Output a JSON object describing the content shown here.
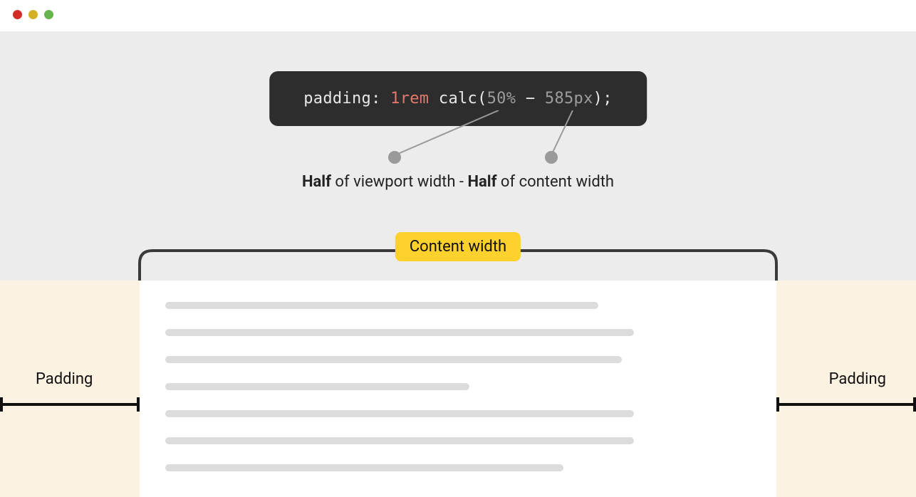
{
  "window": {
    "traffic_light_colors": [
      "#d42d27",
      "#d4b124",
      "#67b34c"
    ]
  },
  "code": {
    "property": "padding",
    "colon": ":",
    "value1": "1rem",
    "func": "calc",
    "lparen": "(",
    "arg1": "50%",
    "operator": "−",
    "arg2": "585px",
    "rparen": ")",
    "semicolon": ";"
  },
  "explain": {
    "bold1": "Half",
    "mid1": " of viewport width - ",
    "bold2": "Half",
    "mid2": " of content width"
  },
  "labels": {
    "content_width": "Content width",
    "padding_left": "Padding",
    "padding_right": "Padding"
  }
}
